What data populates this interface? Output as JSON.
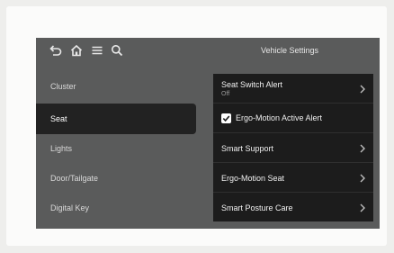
{
  "header": {
    "title": "Vehicle Settings",
    "icons": [
      "back-icon",
      "home-icon",
      "menu-icon",
      "search-icon"
    ]
  },
  "sidebar": {
    "items": [
      {
        "label": "Cluster",
        "active": false
      },
      {
        "label": "Seat",
        "active": true
      },
      {
        "label": "Lights",
        "active": false
      },
      {
        "label": "Door/Tailgate",
        "active": false
      },
      {
        "label": "Digital Key",
        "active": false
      }
    ]
  },
  "panel": {
    "rows": [
      {
        "label": "Seat Switch Alert",
        "sub": "Off",
        "type": "chevron"
      },
      {
        "label": "Ergo-Motion Active Alert",
        "type": "checkbox",
        "checked": true
      },
      {
        "label": "Smart Support",
        "type": "chevron"
      },
      {
        "label": "Ergo-Motion Seat",
        "type": "chevron"
      },
      {
        "label": "Smart Posture Care",
        "type": "chevron"
      }
    ]
  },
  "colors": {
    "screen_bg": "#5a5b5b",
    "panel_bg": "#1c1c1c",
    "active_item_bg": "#222222",
    "checkbox": "#ffffff"
  }
}
